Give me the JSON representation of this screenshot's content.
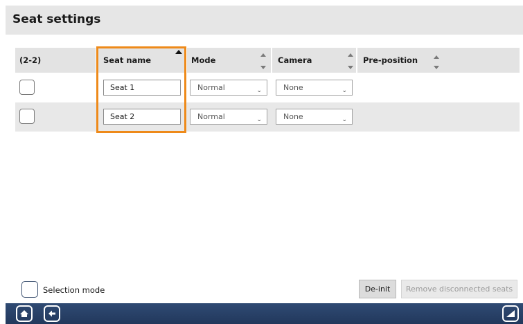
{
  "page": {
    "title": "Seat settings"
  },
  "table": {
    "count_label": "(2-2)",
    "columns": {
      "seat_name": "Seat name",
      "mode": "Mode",
      "camera": "Camera",
      "pre_position": "Pre-position"
    },
    "rows": [
      {
        "seat_name": "Seat 1",
        "mode": "Normal",
        "camera": "None",
        "pre_position": ""
      },
      {
        "seat_name": "Seat 2",
        "mode": "Normal",
        "camera": "None",
        "pre_position": ""
      }
    ],
    "highlight_color": "#ee8a1a"
  },
  "footer_controls": {
    "selection_mode_label": "Selection mode",
    "deinit_label": "De-init",
    "remove_disconnected_label": "Remove disconnected seats"
  },
  "bottom_bar": {
    "color": "#2a4269",
    "icons": [
      "home-icon",
      "back-arrow-icon",
      "corner-triangle-icon"
    ]
  }
}
